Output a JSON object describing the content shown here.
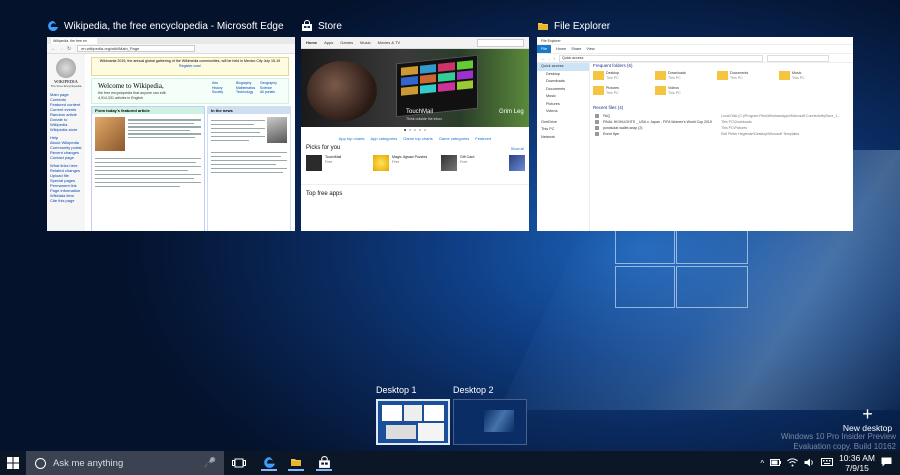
{
  "windows": {
    "edge": {
      "title": "Wikipedia, the free encyclopedia - Microsoft Edge",
      "tab": "Wikipedia, the free en",
      "address": "en.wikipedia.org/wiki/Main_Page",
      "logo_text": "WIKIPEDIA",
      "logo_sub": "The Free Encyclopedia",
      "banner": "Wikimania 2015, the annual global gathering of the Wikimedia communities, will be held in Mexico City July 15-19",
      "banner_link": "Register now!",
      "welcome": "Welcome to Wikipedia,",
      "welcome_sub": "the free encyclopedia that anyone can edit.",
      "article_count": "4,914,331 articles in English",
      "featured_header": "From today's featured article",
      "news_header": "In the news",
      "nav_items": [
        "Main page",
        "Contents",
        "Featured content",
        "Current events",
        "Random article",
        "Donate to Wikipedia",
        "Wikipedia store"
      ],
      "interaction_items": [
        "Help",
        "About Wikipedia",
        "Community portal",
        "Recent changes",
        "Contact page"
      ],
      "tools_items": [
        "What links here",
        "Related changes",
        "Upload file",
        "Special pages",
        "Permanent link",
        "Page information",
        "Wikidata item",
        "Cite this page"
      ],
      "portals": [
        "Arts",
        "Biography",
        "Geography",
        "History",
        "Mathematics",
        "Science",
        "Society",
        "Technology",
        "All portals"
      ]
    },
    "store": {
      "title": "Store",
      "tabs": [
        "Home",
        "Apps",
        "Games",
        "Music",
        "Movies & TV"
      ],
      "hero_title": "TouchMail",
      "hero_sub": "Think outside the inbox",
      "hero_side": "Grim Leg",
      "links": [
        "App top charts",
        "App categories",
        "Game top charts",
        "Game categories",
        "Featured"
      ],
      "picks_label": "Picks for you",
      "picks_show_all": "Show all",
      "picks": [
        {
          "name": "TouchMail",
          "sub": "Free"
        },
        {
          "name": "Magic Jigsaw Puzzles",
          "sub": "Free"
        },
        {
          "name": "Gift Card",
          "sub": "Free"
        }
      ],
      "top_free_label": "Top free apps"
    },
    "file_explorer": {
      "title": "File Explorer",
      "ribbon_tabs": [
        "File",
        "Home",
        "Share",
        "View"
      ],
      "address": "Quick access",
      "quick_access_label": "Quick access",
      "frequent_header": "Frequent folders (6)",
      "recent_header": "Recent files (4)",
      "nav_items": [
        "Quick access",
        "Desktop",
        "Downloads",
        "Documents",
        "Music",
        "Pictures",
        "Videos",
        "OneDrive",
        "This PC",
        "Network"
      ],
      "folders": [
        {
          "name": "Desktop",
          "sub": "This PC"
        },
        {
          "name": "Downloads",
          "sub": "This PC"
        },
        {
          "name": "Documents",
          "sub": "This PC"
        },
        {
          "name": "Music",
          "sub": "This PC"
        },
        {
          "name": "Pictures",
          "sub": "This PC"
        },
        {
          "name": "Videos",
          "sub": "This PC"
        }
      ],
      "recent_files": [
        {
          "name": "FAQ",
          "path": "Local Disk (C:)\\Program Files\\WindowsApps\\Microsoft.ConnectivityStore_1..."
        },
        {
          "name": "FINAL HIGHLIGHTS _ USA v. Japan - FIFA Women's World Cup 2015",
          "path": "This PC\\Downloads"
        },
        {
          "name": "pondsolar-wallet-snap (2)",
          "path": "This PC\\Pictures"
        },
        {
          "name": "Event flyer",
          "path": "Edit Pieter Hegeman\\Desktop\\Microsoft Templates"
        }
      ]
    }
  },
  "desktops": [
    {
      "label": "Desktop 1"
    },
    {
      "label": "Desktop 2"
    }
  ],
  "new_desktop_label": "New desktop",
  "watermark": {
    "line1": "Windows 10 Pro Insider Preview",
    "line2": "Evaluation copy. Build 10162"
  },
  "taskbar": {
    "search_placeholder": "Ask me anything",
    "time": "10:36 AM",
    "date": "7/9/15"
  },
  "colors": {
    "accent": "#1e90ff",
    "taskbar": "#0b1626",
    "search": "#3b4352"
  }
}
